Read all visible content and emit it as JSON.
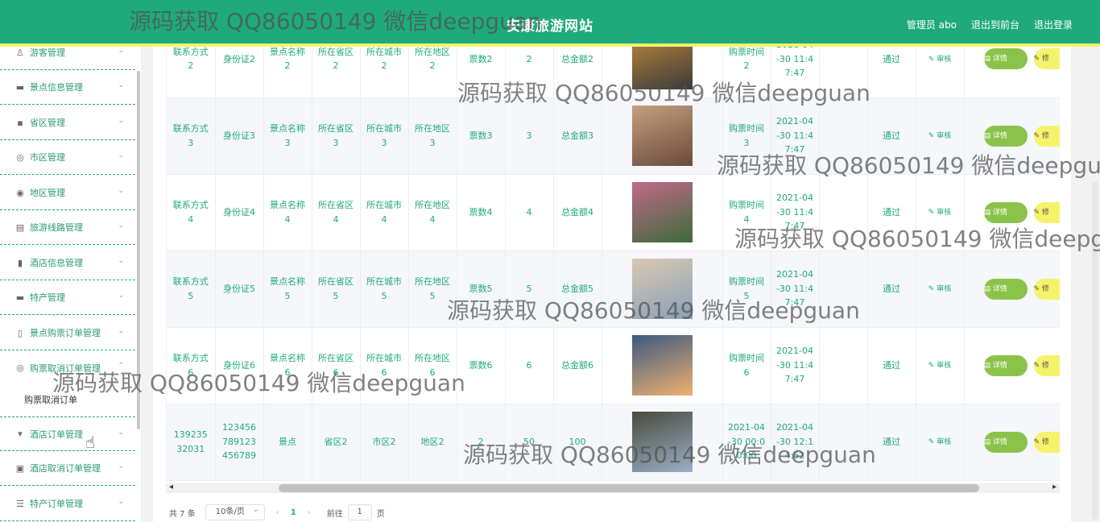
{
  "header": {
    "title": "安康旅游网站",
    "user": "管理员 abo",
    "to_front": "退出到前台",
    "logout": "退出登录"
  },
  "sidebar": {
    "items": [
      {
        "label": "游客管理",
        "icon": "user-icon"
      },
      {
        "label": "景点信息管理",
        "icon": "monitor-icon"
      },
      {
        "label": "省区管理",
        "icon": "chat-icon"
      },
      {
        "label": "市区管理",
        "icon": "compass-icon"
      },
      {
        "label": "地区管理",
        "icon": "target-icon"
      },
      {
        "label": "旅游线路管理",
        "icon": "clipboard-icon"
      },
      {
        "label": "酒店信息管理",
        "icon": "bar-chart-icon"
      },
      {
        "label": "特产管理",
        "icon": "briefcase-icon"
      },
      {
        "label": "景点购票订单管理",
        "icon": "phone-icon"
      },
      {
        "label": "购票取消订单管理",
        "icon": "compass-icon"
      },
      {
        "label": "酒店订单管理",
        "icon": "trophy-icon"
      },
      {
        "label": "酒店取消订单管理",
        "icon": "clipboard-icon"
      },
      {
        "label": "特产订单管理",
        "icon": "menu-icon"
      }
    ],
    "sub_item": "购票取消订单"
  },
  "table": {
    "rows": [
      {
        "c1": "联系方式2",
        "c2": "身份证2",
        "c3": "景点名称2",
        "c4": "所在省区2",
        "c5": "所在城市2",
        "c6": "所在地区2",
        "c7": "票数2",
        "c8": "2",
        "c9": "总金额2",
        "c10": "购票时间2",
        "c11": "2021-04-30 11:47:47",
        "status": "通过",
        "audit": "审核",
        "detail": "详情",
        "edit": "修"
      },
      {
        "c1": "联系方式3",
        "c2": "身份证3",
        "c3": "景点名称3",
        "c4": "所在省区3",
        "c5": "所在城市3",
        "c6": "所在地区3",
        "c7": "票数3",
        "c8": "3",
        "c9": "总金额3",
        "c10": "购票时间3",
        "c11": "2021-04-30 11:47:47",
        "status": "通过",
        "audit": "审核",
        "detail": "详情",
        "edit": "修"
      },
      {
        "c1": "联系方式4",
        "c2": "身份证4",
        "c3": "景点名称4",
        "c4": "所在省区4",
        "c5": "所在城市4",
        "c6": "所在地区4",
        "c7": "票数4",
        "c8": "4",
        "c9": "总金额4",
        "c10": "购票时间4",
        "c11": "2021-04-30 11:47:47",
        "status": "通过",
        "audit": "审核",
        "detail": "详情",
        "edit": "修"
      },
      {
        "c1": "联系方式5",
        "c2": "身份证5",
        "c3": "景点名称5",
        "c4": "所在省区5",
        "c5": "所在城市5",
        "c6": "所在地区5",
        "c7": "票数5",
        "c8": "5",
        "c9": "总金额5",
        "c10": "购票时间5",
        "c11": "2021-04-30 11:47:47",
        "status": "通过",
        "audit": "审核",
        "detail": "详情",
        "edit": "修"
      },
      {
        "c1": "联系方式6",
        "c2": "身份证6",
        "c3": "景点名称6",
        "c4": "所在省区6",
        "c5": "所在城市6",
        "c6": "所在地区6",
        "c7": "票数6",
        "c8": "6",
        "c9": "总金额6",
        "c10": "购票时间6",
        "c11": "2021-04-30 11:47:47",
        "status": "通过",
        "audit": "审核",
        "detail": "详情",
        "edit": "修"
      },
      {
        "c1": "13923532031",
        "c2": "123456789123456789",
        "c3": "景点",
        "c4": "省区2",
        "c5": "市区2",
        "c6": "地区2",
        "c7": "2",
        "c8": "50",
        "c9": "100",
        "c10": "2021-04-30 00:00:00",
        "c11": "2021-04-30 12:14:52",
        "status": "通过",
        "audit": "审核",
        "detail": "详情",
        "edit": "修"
      }
    ],
    "image_colors": [
      [
        "#3a3a3a",
        "#c48a3a"
      ],
      [
        "#6b4a3a",
        "#c2a080"
      ],
      [
        "#3d6b3a",
        "#c06a8a"
      ],
      [
        "#8aa0b8",
        "#d8c8b0"
      ],
      [
        "#f0b070",
        "#3a5a80"
      ],
      [
        "#9ab0c8",
        "#4a4a3a"
      ]
    ]
  },
  "pagination": {
    "total": "共 7 条",
    "page_size": "10条/页",
    "prev": "‹",
    "current": "1",
    "next": "›",
    "goto_label": "前往",
    "goto_value": "1",
    "page_unit": "页"
  },
  "watermark": "源码获取 QQ86050149 微信deepguan",
  "colors": {
    "primary": "#1faa7b",
    "accent": "#f5f36a",
    "detail_button": "#8bc34a"
  }
}
